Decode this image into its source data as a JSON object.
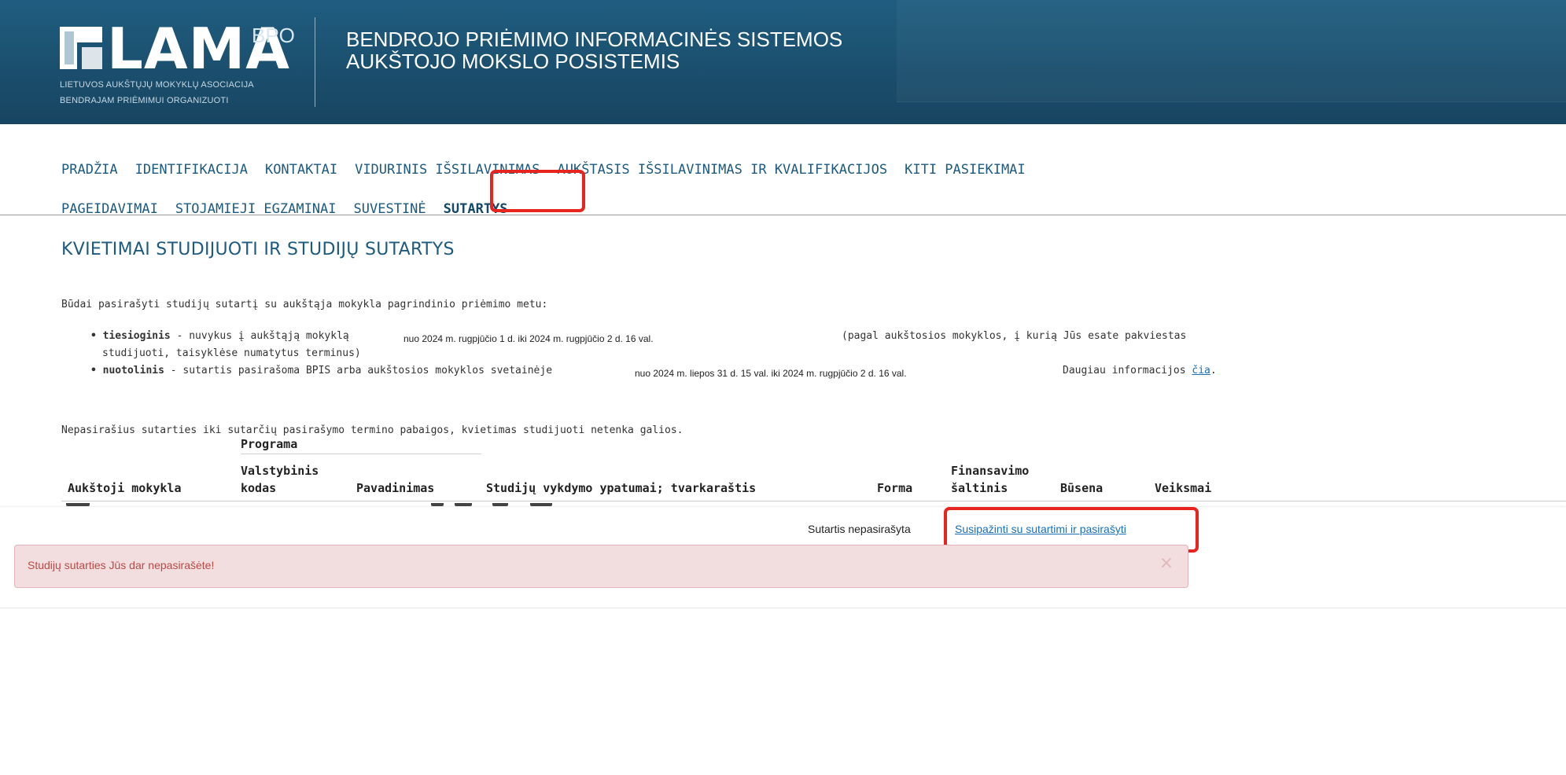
{
  "header": {
    "logo_text": "LAMA",
    "logo_sup": "BPO",
    "logo_sub_line1": "LIETUVOS AUKŠTŲJŲ MOKYKLŲ ASOCIACIJA",
    "logo_sub_line2": "BENDRAJAM PRIĖMIMUI ORGANIZUOTI",
    "system_title_line1": "BENDROJO PRIĖMIMO INFORMACINĖS SISTEMOS",
    "system_title_line2": "AUKŠTOJO MOKSLO POSISTEMIS"
  },
  "nav": {
    "row1": [
      "PRADŽIA",
      "IDENTIFIKACIJA",
      "KONTAKTAI",
      "VIDURINIS IŠSILAVINIMAS",
      "AUKŠTASIS IŠSILAVINIMAS IR KVALIFIKACIJOS",
      "KITI PASIEKIMAI"
    ],
    "row2": [
      "PAGEIDAVIMAI",
      "STOJAMIEJI EGZAMINAI",
      "SUVESTINĖ",
      "SUTARTYS"
    ],
    "active": "SUTARTYS"
  },
  "page": {
    "title": "KVIETIMAI STUDIJUOTI IR STUDIJŲ SUTARTYS",
    "intro": "Būdai pasirašyti studijų sutartį su aukštąja mokykla pagrindinio priėmimo metu:",
    "bullet1": {
      "term": "tiesioginis",
      "text": " - nuvykus į aukštąją mokyklą",
      "dates": "nuo 2024 m. rugpjūčio 1 d. iki 2024 m.  rugpjūčio 2 d. 16 val.",
      "note": "(pagal aukštosios mokyklos, į kurią Jūs esate pakviestas",
      "note2": "studijuoti, taisyklėse numatytus terminus)"
    },
    "bullet2": {
      "term": "nuotolinis",
      "text": " - sutartis pasirašoma BPIS arba aukštosios mokyklos svetainėje",
      "dates": "nuo 2024 m. liepos 31 d. 15 val. iki 2024 m. rugpjūčio 2 d. 16 val.",
      "more": "Daugiau informacijos ",
      "more_link": "čia",
      "more_end": "."
    },
    "note": "Nepasirašius sutarties iki sutarčių pasirašymo termino pabaigos, kvietimas studijuoti netenka galios."
  },
  "table": {
    "group_header": "Programa",
    "columns": {
      "school": "Aukštoji mokykla",
      "code_line1": "Valstybinis",
      "code_line2": "kodas",
      "name": "Pavadinimas",
      "features": "Studijų vykdymo ypatumai; tvarkaraštis",
      "form": "Forma",
      "funding_line1": "Finansavimo",
      "funding_line2": "šaltinis",
      "status": "Būsena",
      "actions": "Veiksmai"
    }
  },
  "contract": {
    "status": "Sutartis nepasirašyta",
    "sign_link": "Susipažinti su sutartimi ir pasirašyti"
  },
  "alert": {
    "message": "Studijų sutarties Jūs dar nepasirašėte!",
    "close": "×"
  },
  "colors": {
    "header_bg": "#1b4f6e",
    "nav_link": "#1c5a80",
    "highlight": "#e8241e",
    "alert_bg": "#f2dede",
    "alert_text": "#b94a48",
    "link": "#1a6fb5"
  }
}
